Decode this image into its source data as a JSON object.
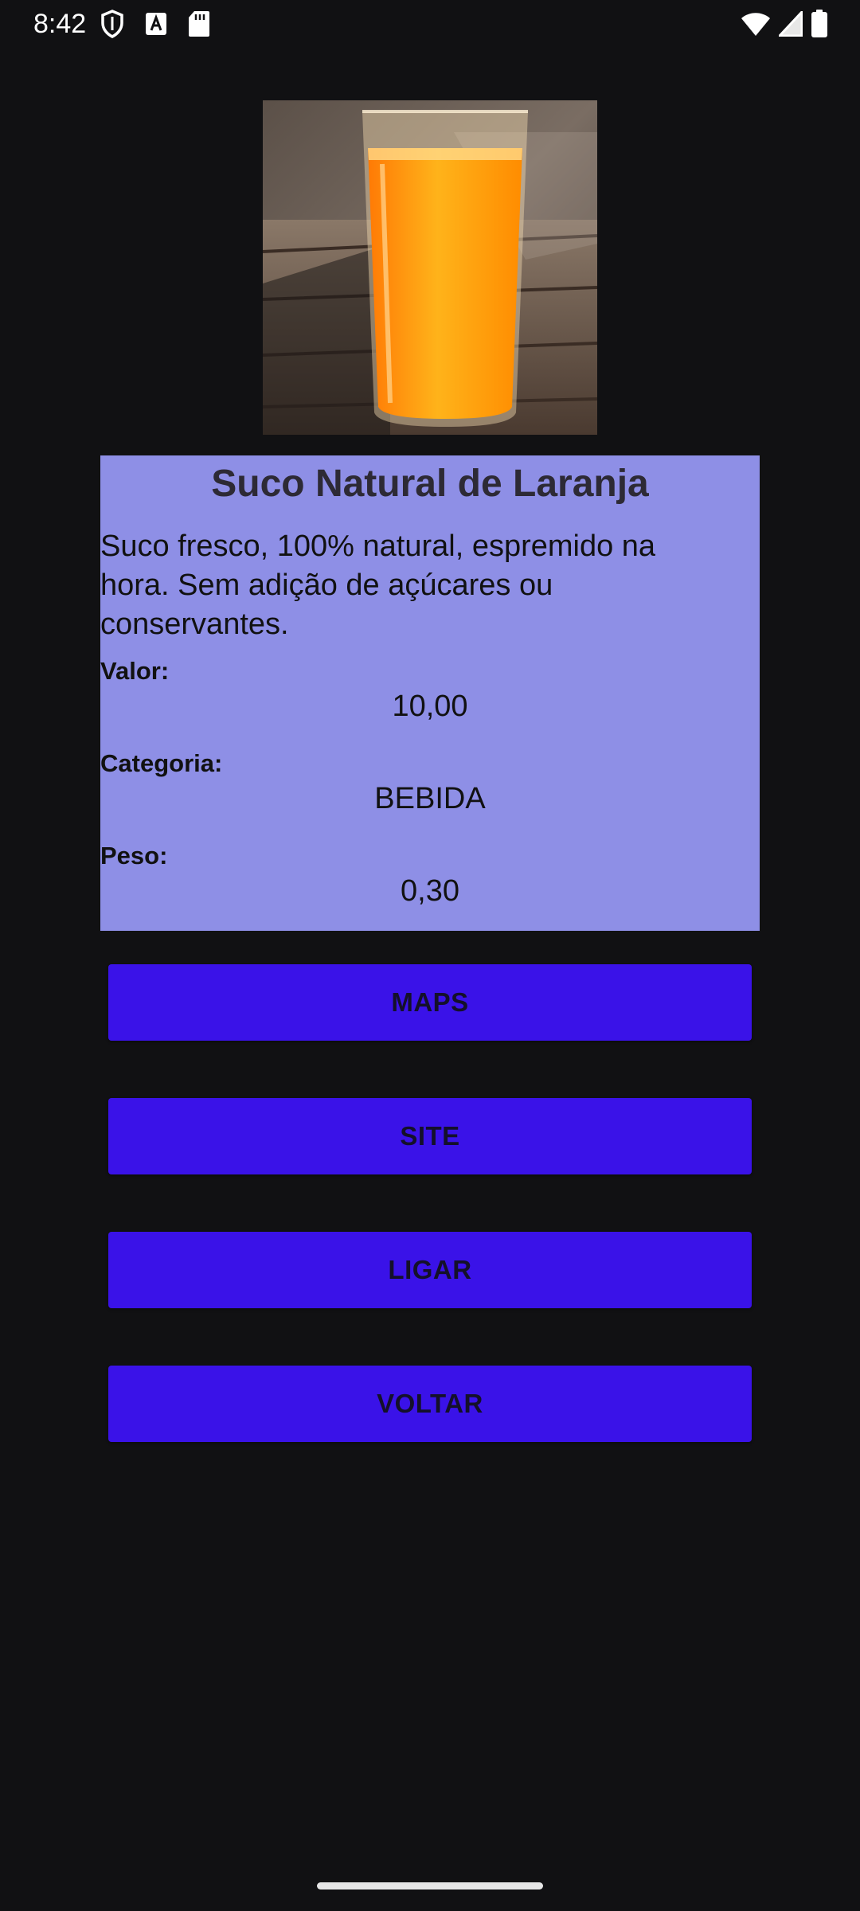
{
  "status_bar": {
    "time": "8:42",
    "left_icons": [
      "shield-icon",
      "font-a-icon",
      "sd-card-icon"
    ],
    "right_icons": [
      "wifi-icon",
      "signal-icon",
      "battery-icon"
    ]
  },
  "product": {
    "image_icon": "orange-juice-glass-image",
    "title": "Suco Natural de Laranja",
    "description": "Suco fresco, 100% natural, espremido na hora. Sem adição de açúcares ou conservantes.",
    "value_label": "Valor:",
    "value": "10,00",
    "category_label": "Categoria:",
    "category": "BEBIDA",
    "weight_label": "Peso:",
    "weight": "0,30"
  },
  "buttons": {
    "maps": "MAPS",
    "site": "SITE",
    "call": "LIGAR",
    "back": "VOLTAR"
  },
  "colors": {
    "background": "#111113",
    "card": "#8e8fe6",
    "button": "#3a12e8"
  }
}
